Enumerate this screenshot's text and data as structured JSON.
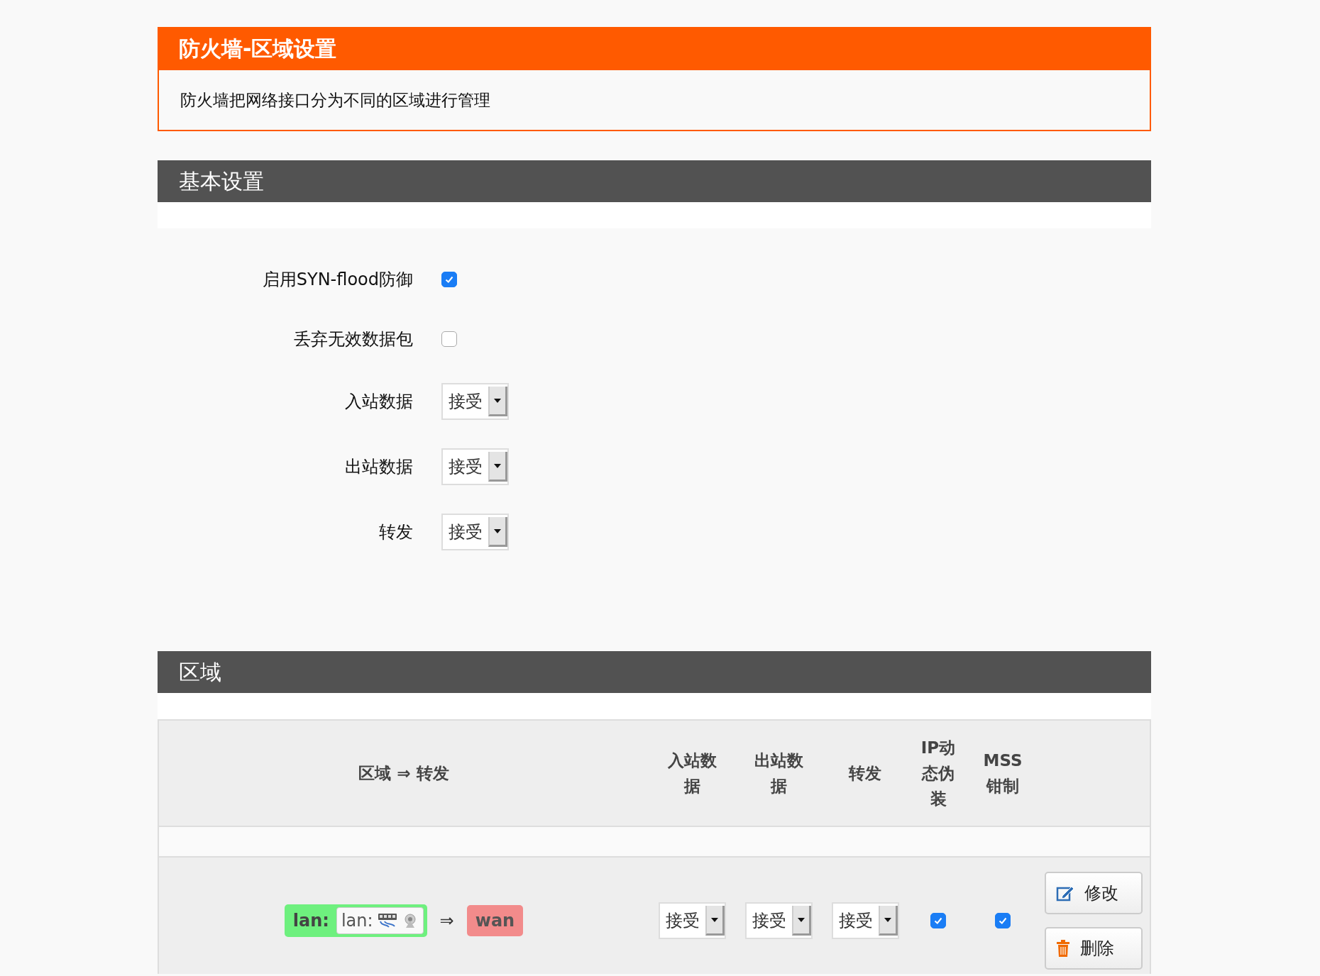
{
  "page_title": "防火墙-区域设置",
  "description": "防火墙把网络接口分为不同的区域进行管理",
  "basic_settings": {
    "title": "基本设置",
    "fields": [
      {
        "kind": "checkbox",
        "label": "启用SYN-flood防御",
        "checked": true
      },
      {
        "kind": "checkbox",
        "label": "丢弃无效数据包",
        "checked": false
      },
      {
        "kind": "select",
        "label": "入站数据",
        "value": "接受"
      },
      {
        "kind": "select",
        "label": "出站数据",
        "value": "接受"
      },
      {
        "kind": "select",
        "label": "转发",
        "value": "接受"
      }
    ]
  },
  "zones": {
    "title": "区域",
    "columns": [
      "区域 ⇒ 转发",
      "入站数据",
      "出站数据",
      "转发",
      "IP动态伪装",
      "MSS钳制"
    ],
    "rows": [
      {
        "zone": {
          "name": "lan:",
          "color": "#6ef07e",
          "interface_label": "lan:"
        },
        "arrow": "⇒",
        "forward_zones": [
          {
            "name": "wan",
            "color": "#f28b8b"
          }
        ],
        "input": "接受",
        "output": "接受",
        "forward": "接受",
        "masquerade": true,
        "mss_clamping": true,
        "buttons": [
          {
            "kind": "edit",
            "label": "修改"
          },
          {
            "kind": "delete",
            "label": "删除"
          }
        ]
      }
    ]
  }
}
